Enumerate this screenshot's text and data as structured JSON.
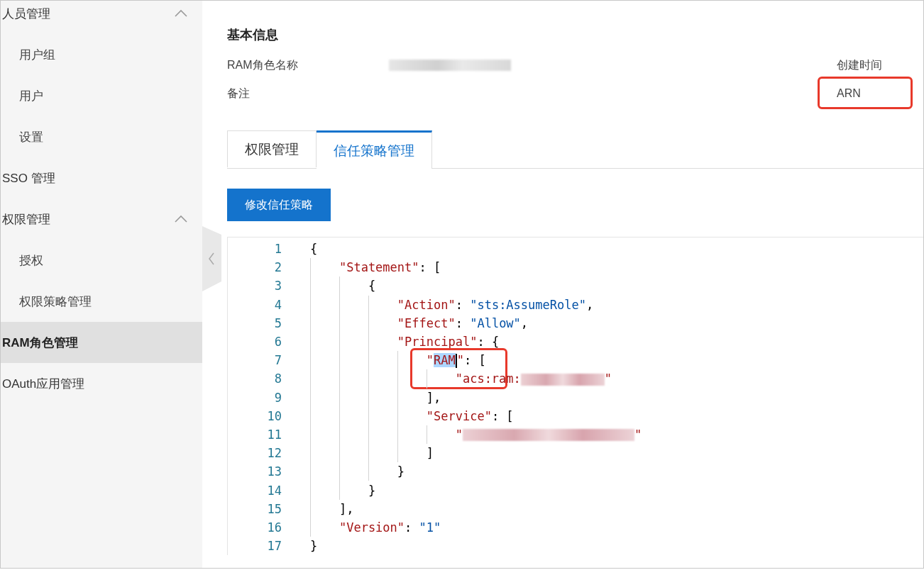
{
  "sidebar": {
    "items": [
      {
        "label": "人员管理",
        "selected": false,
        "expanded": true,
        "children": [
          {
            "label": "用户组",
            "selected": false
          },
          {
            "label": "用户",
            "selected": false
          },
          {
            "label": "设置",
            "selected": false
          }
        ]
      },
      {
        "label": "SSO 管理",
        "selected": false
      },
      {
        "label": "权限管理",
        "selected": false,
        "expanded": true,
        "children": [
          {
            "label": "授权",
            "selected": false
          },
          {
            "label": "权限策略管理",
            "selected": false
          }
        ]
      },
      {
        "label": "RAM角色管理",
        "selected": true
      },
      {
        "label": "OAuth应用管理",
        "selected": false
      }
    ]
  },
  "basic_info": {
    "title": "基本信息",
    "fields_left": [
      {
        "label": "RAM角色名称",
        "redacted": true
      },
      {
        "label": "备注",
        "redacted": false
      }
    ],
    "fields_right": [
      {
        "label": "创建时间",
        "highlighted": false
      },
      {
        "label": "ARN",
        "highlighted": true
      }
    ]
  },
  "tabs": [
    {
      "label": "权限管理",
      "selected": false
    },
    {
      "label": "信任策略管理",
      "selected": true
    }
  ],
  "edit_button": "修改信任策略",
  "editor": {
    "lines": [
      {
        "number": "1",
        "tokens": [
          {
            "kind": "punct",
            "text": "{"
          }
        ]
      },
      {
        "number": "2",
        "tokens": [
          {
            "kind": "key",
            "text": "\"Statement\""
          },
          {
            "kind": "punct",
            "text": ": ["
          }
        ]
      },
      {
        "number": "3",
        "tokens": [
          {
            "kind": "punct",
            "text": "{"
          }
        ]
      },
      {
        "number": "4",
        "tokens": [
          {
            "kind": "key",
            "text": "\"Action\""
          },
          {
            "kind": "punct",
            "text": ": "
          },
          {
            "kind": "string",
            "text": "\"sts:AssumeRole\""
          },
          {
            "kind": "punct",
            "text": ","
          }
        ]
      },
      {
        "number": "5",
        "tokens": [
          {
            "kind": "key",
            "text": "\"Effect\""
          },
          {
            "kind": "punct",
            "text": ": "
          },
          {
            "kind": "string",
            "text": "\"Allow\""
          },
          {
            "kind": "punct",
            "text": ","
          }
        ]
      },
      {
        "number": "6",
        "tokens": [
          {
            "kind": "key",
            "text": "\"Principal\""
          },
          {
            "kind": "punct",
            "text": ": {"
          }
        ]
      },
      {
        "number": "7",
        "highlighted": true,
        "tokens": [
          {
            "kind": "key",
            "text": "\""
          },
          {
            "kind": "key",
            "text": "RAM",
            "selected": true
          },
          {
            "kind": "cursor"
          },
          {
            "kind": "key",
            "text": "\""
          },
          {
            "kind": "punct",
            "text": ": ["
          }
        ]
      },
      {
        "number": "8",
        "tokens": [
          {
            "kind": "key",
            "text": "\"acs:ram:"
          },
          {
            "kind": "redacted"
          },
          {
            "kind": "key",
            "text": "\""
          }
        ]
      },
      {
        "number": "9",
        "tokens": [
          {
            "kind": "punct",
            "text": "],"
          }
        ]
      },
      {
        "number": "10",
        "tokens": [
          {
            "kind": "key",
            "text": "\"Service\""
          },
          {
            "kind": "punct",
            "text": ": ["
          }
        ]
      },
      {
        "number": "11",
        "tokens": [
          {
            "kind": "key",
            "text": "\""
          },
          {
            "kind": "redacted_long"
          },
          {
            "kind": "key",
            "text": "\""
          }
        ]
      },
      {
        "number": "12",
        "tokens": [
          {
            "kind": "punct",
            "text": "]"
          }
        ]
      },
      {
        "number": "13",
        "tokens": [
          {
            "kind": "punct",
            "text": "}"
          }
        ]
      },
      {
        "number": "14",
        "tokens": [
          {
            "kind": "punct",
            "text": "}"
          }
        ]
      },
      {
        "number": "15",
        "tokens": [
          {
            "kind": "punct",
            "text": "],"
          }
        ]
      },
      {
        "number": "16",
        "tokens": [
          {
            "kind": "key",
            "text": "\"Version\""
          },
          {
            "kind": "punct",
            "text": ": "
          },
          {
            "kind": "string",
            "text": "\"1\""
          }
        ]
      },
      {
        "number": "17",
        "tokens": [
          {
            "kind": "punct",
            "text": "}"
          }
        ]
      }
    ]
  }
}
